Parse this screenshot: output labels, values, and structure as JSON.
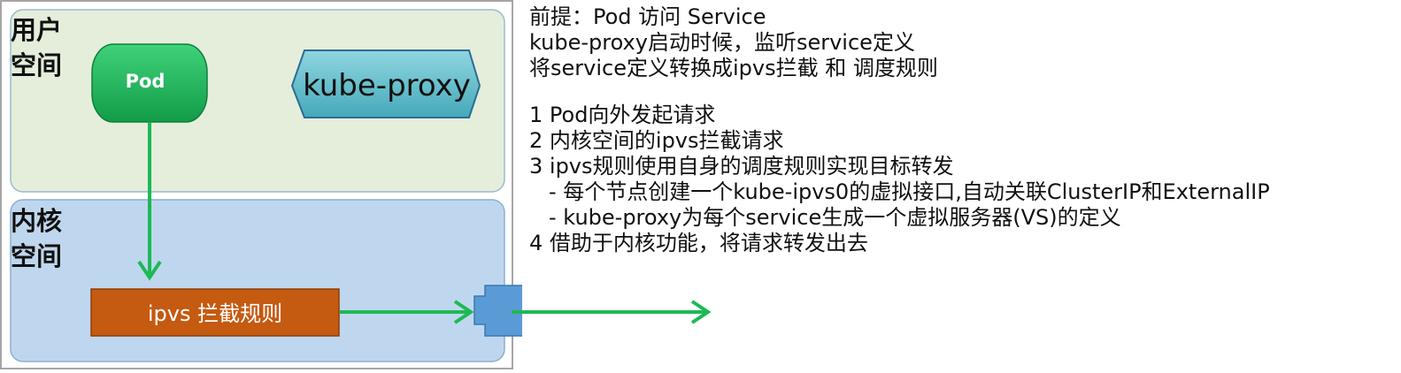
{
  "diagram": {
    "user_space_label": [
      "用户",
      "空间"
    ],
    "kernel_space_label": [
      "内核",
      "空间"
    ],
    "pod_label": "Pod",
    "kube_proxy_label": "kube-proxy",
    "ipvs_label": "ipvs 拦截规则",
    "colors": {
      "user_space_fill": "#e4eedb",
      "kernel_space_fill": "#bfd7ee",
      "pod_fill": "#19b359",
      "kube_proxy_fill": "#5bbecd",
      "ipvs_fill": "#c55a11",
      "interface_fill": "#5b9bd5",
      "arrow": "#1db954"
    }
  },
  "notes": {
    "premise": [
      "前提：Pod 访问 Service",
      "kube-proxy启动时候，监听service定义",
      "将service定义转换成ipvs拦截 和 调度规则"
    ],
    "steps": [
      "1 Pod向外发起请求",
      "2 内核空间的ipvs拦截请求",
      "3 ipvs规则使用自身的调度规则实现目标转发",
      "4 借助于内核功能，将请求转发出去"
    ],
    "sub_steps": [
      "- 每个节点创建一个kube-ipvs0的虚拟接口,自动关联ClusterIP和ExternalIP",
      "- kube-proxy为每个service生成一个虚拟服务器(VS)的定义"
    ]
  }
}
